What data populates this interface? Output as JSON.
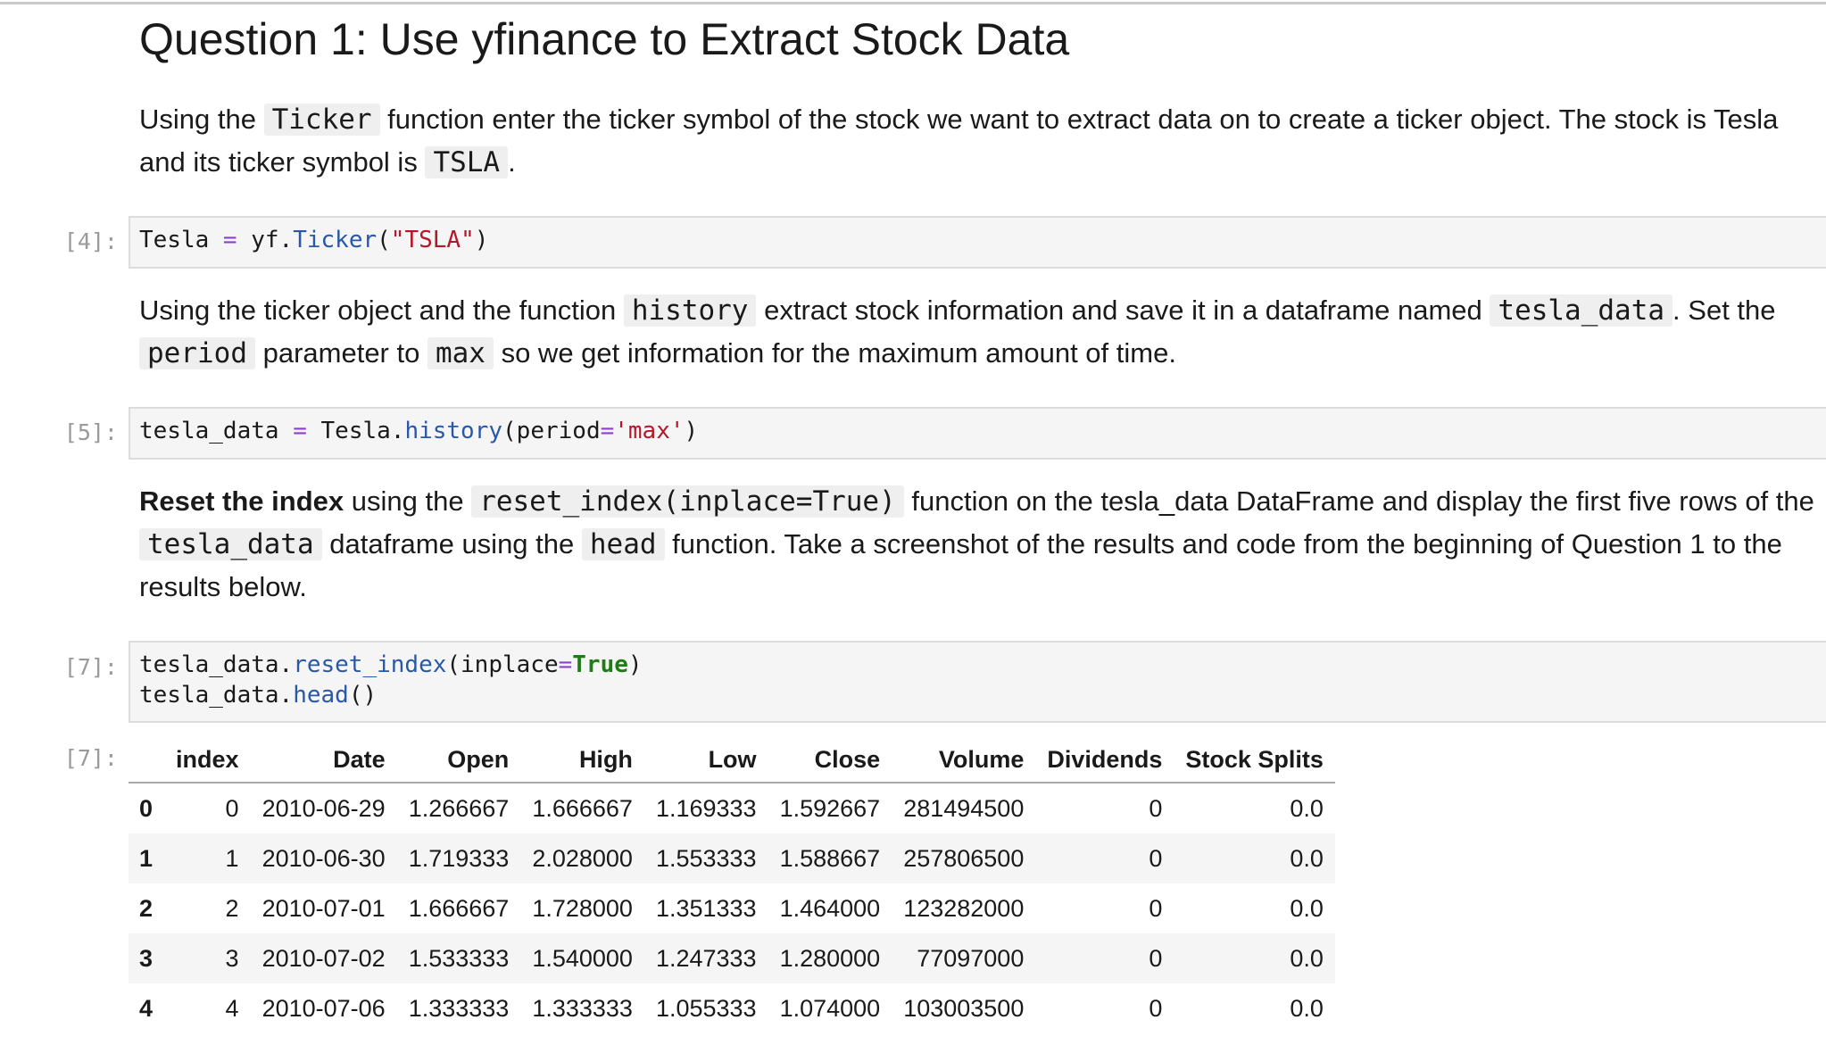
{
  "heading": "Question 1: Use yfinance to Extract Stock Data",
  "para1": {
    "t1": "Using the ",
    "c1": "Ticker",
    "t2": " function enter the ticker symbol of the stock we want to extract data on to create a ticker object. The stock is Tesla and its ticker symbol is ",
    "c2": "TSLA",
    "t3": "."
  },
  "cell4": {
    "prompt": "[4]:",
    "var": "Tesla",
    "eq": " = ",
    "obj": "yf.",
    "fn": "Ticker",
    "open": "(",
    "arg": "\"TSLA\"",
    "close": ")"
  },
  "para2": {
    "t1": "Using the ticker object and the function ",
    "c1": "history",
    "t2": " extract stock information and save it in a dataframe named ",
    "c2": "tesla_data",
    "t3": ". Set the ",
    "c3": "period",
    "t4": " parameter to ",
    "c4": "max",
    "t5": " so we get information for the maximum amount of time."
  },
  "cell5": {
    "prompt": "[5]:",
    "var": "tesla_data",
    "eq": " = ",
    "obj": "Tesla.",
    "fn": "history",
    "open": "(",
    "param": "period",
    "peq": "=",
    "arg": "'max'",
    "close": ")"
  },
  "para3": {
    "b1": "Reset the index",
    "t1": " using the ",
    "c1": "reset_index(inplace=True)",
    "t2": " function on the tesla_data DataFrame and display the first five rows of the ",
    "c2": "tesla_data",
    "t3": " dataframe using the ",
    "c3": "head",
    "t4": " function. Take a screenshot of the results and code from the beginning of Question 1 to the results below."
  },
  "cell7": {
    "prompt": "[7]:",
    "l1_obj": "tesla_data.",
    "l1_fn": "reset_index",
    "l1_open": "(",
    "l1_param": "inplace",
    "l1_eq": "=",
    "l1_kw": "True",
    "l1_close": ")",
    "l2_obj": "tesla_data.",
    "l2_fn": "head",
    "l2_paren": "()"
  },
  "output7": {
    "prompt": "[7]:",
    "columns": [
      "",
      "index",
      "Date",
      "Open",
      "High",
      "Low",
      "Close",
      "Volume",
      "Dividends",
      "Stock Splits"
    ],
    "rows": [
      [
        "0",
        "0",
        "2010-06-29",
        "1.266667",
        "1.666667",
        "1.169333",
        "1.592667",
        "281494500",
        "0",
        "0.0"
      ],
      [
        "1",
        "1",
        "2010-06-30",
        "1.719333",
        "2.028000",
        "1.553333",
        "1.588667",
        "257806500",
        "0",
        "0.0"
      ],
      [
        "2",
        "2",
        "2010-07-01",
        "1.666667",
        "1.728000",
        "1.351333",
        "1.464000",
        "123282000",
        "0",
        "0.0"
      ],
      [
        "3",
        "3",
        "2010-07-02",
        "1.533333",
        "1.540000",
        "1.247333",
        "1.280000",
        "77097000",
        "0",
        "0.0"
      ],
      [
        "4",
        "4",
        "2010-07-06",
        "1.333333",
        "1.333333",
        "1.055333",
        "1.074000",
        "103003500",
        "0",
        "0.0"
      ]
    ]
  }
}
